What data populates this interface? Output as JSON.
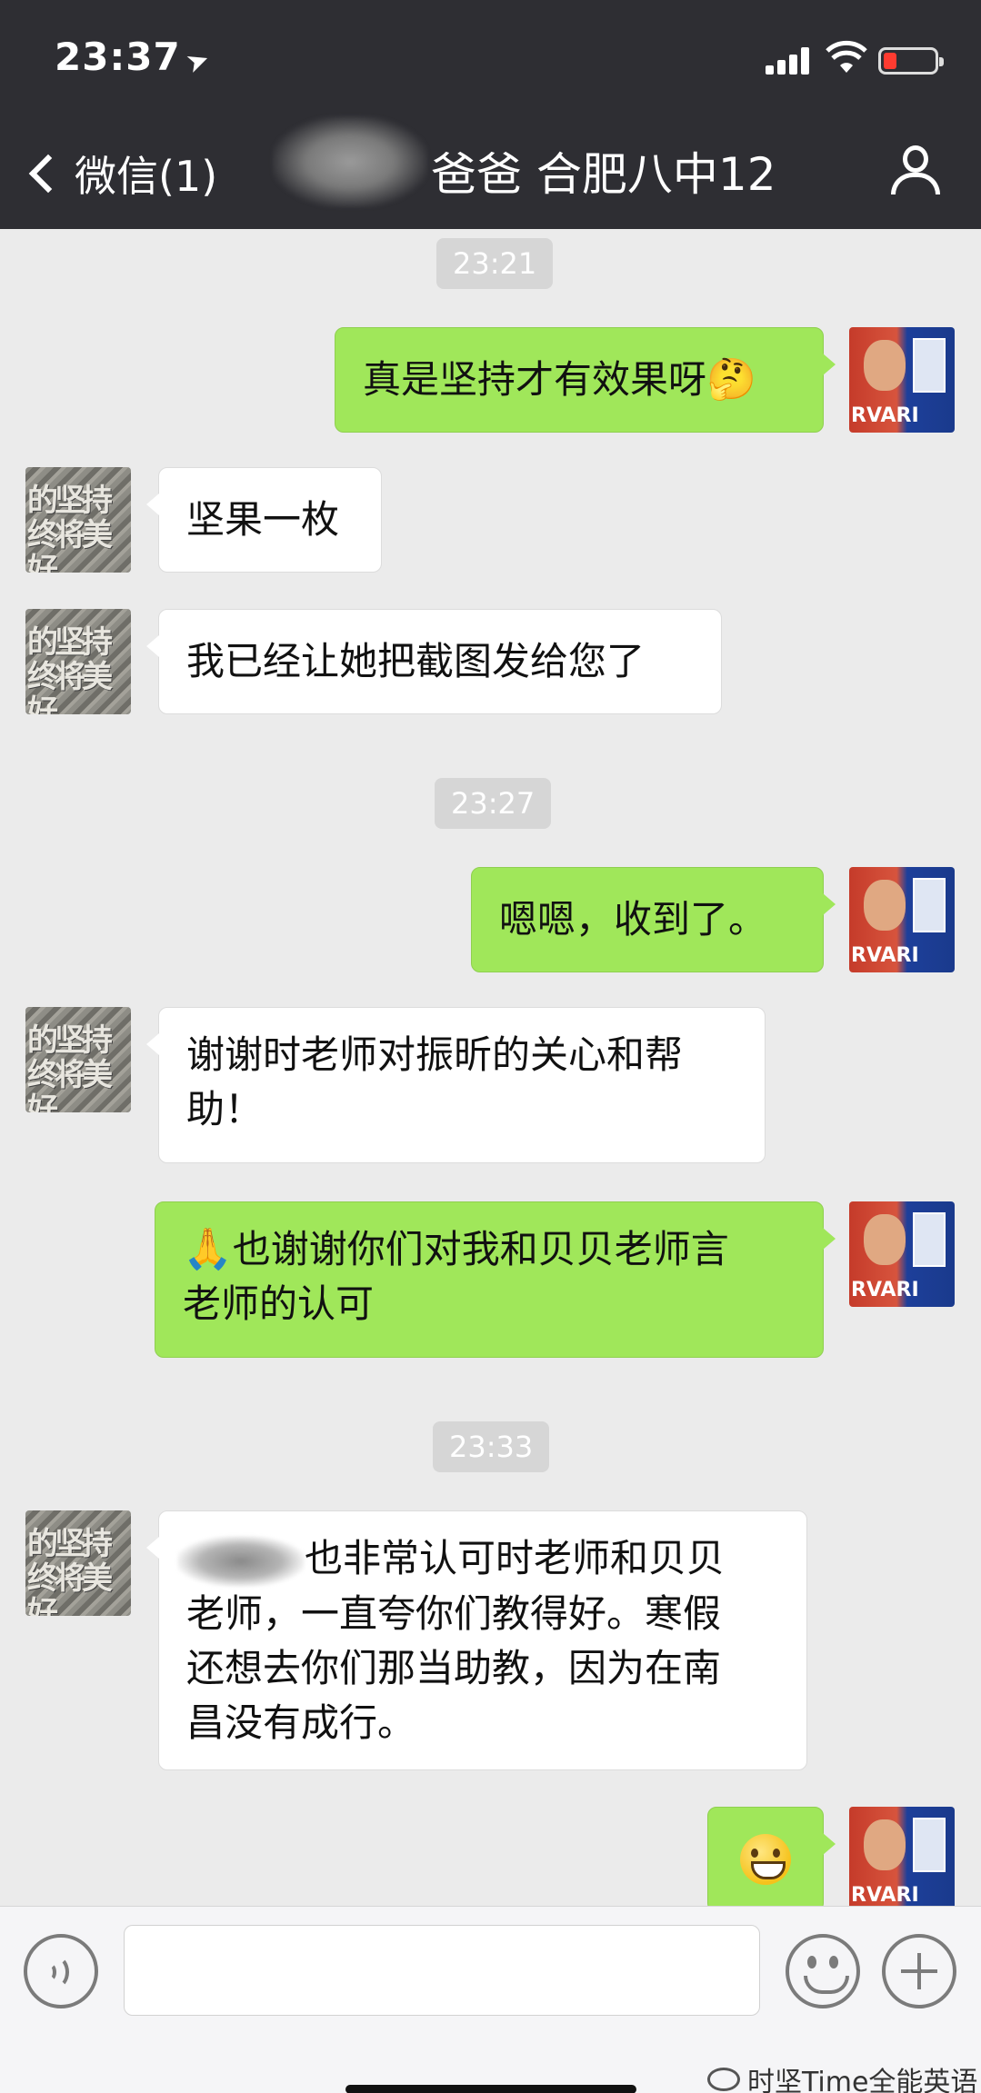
{
  "status_bar": {
    "time": "23:37"
  },
  "header": {
    "back_label": "微信(1)",
    "title": "爸爸 合肥八中12"
  },
  "messages": {
    "t1": "23:21",
    "m1": "真是坚持才有效果呀",
    "m2": "坚果一枚",
    "m3": "我已经让她把截图发给您了",
    "t2": "23:27",
    "m4": "嗯嗯，收到了。",
    "m5_line1": "谢谢时老师对振昕的关心和帮",
    "m5_line2": "助！",
    "m6_emoji": "🙏",
    "m6_line1": "也谢谢你们对我和贝贝老师言",
    "m6_line2": "老师的认可",
    "t3": "23:33",
    "m7_line1": "也非常认可时老师和贝贝",
    "m7_line2": "老师，一直夸你们教得好。寒假",
    "m7_line3": "还想去你们那当助教，因为在南",
    "m7_line4": "昌没有成行。"
  },
  "avatars": {
    "left_text_1": "的坚持",
    "left_text_2": "终将美好",
    "right_text": "RVARI"
  },
  "footer": {
    "watermark": "时坚Time全能英语"
  },
  "colors": {
    "header_bg": "#2e2e33",
    "chat_bg": "#ebebeb",
    "sent_bubble": "#a0e75a",
    "received_bubble": "#ffffff"
  },
  "icons": [
    "back-chevron-icon",
    "profile-icon",
    "voice-icon",
    "emoji-icon",
    "plus-icon",
    "wechat-icon"
  ]
}
